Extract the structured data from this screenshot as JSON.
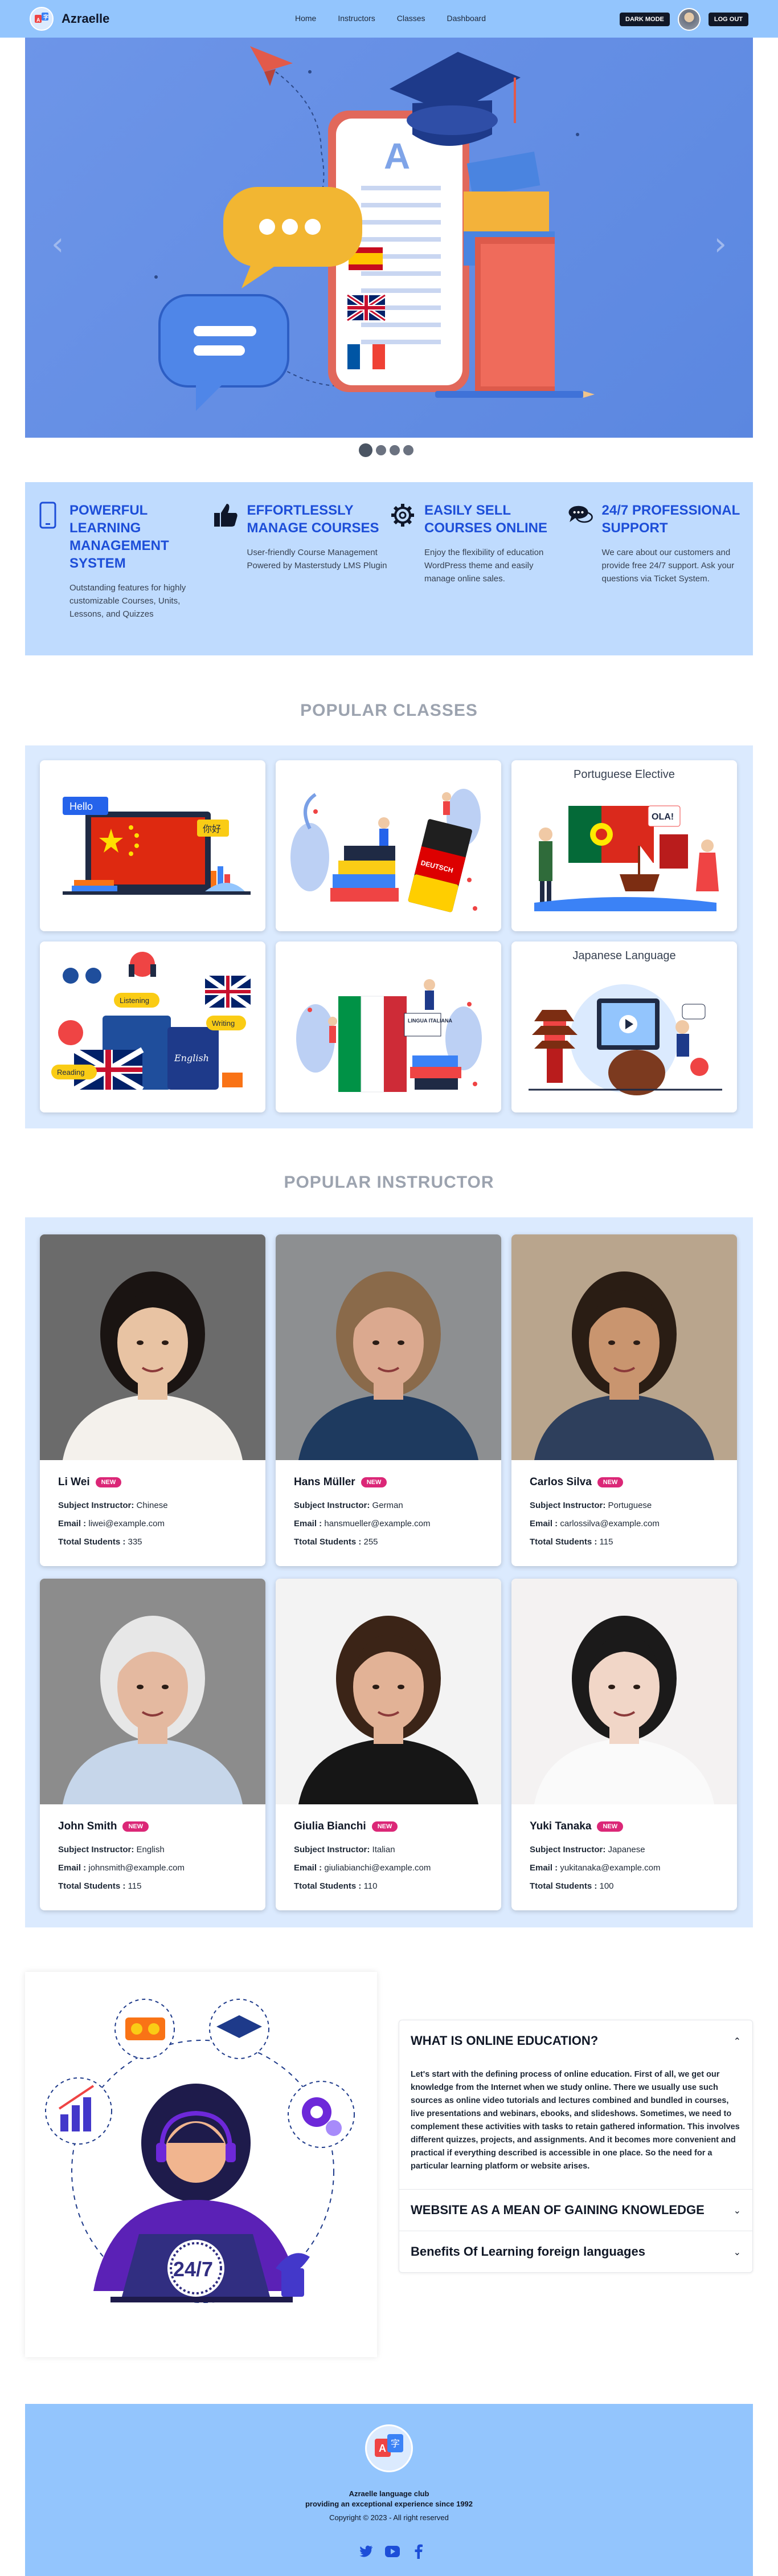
{
  "nav": {
    "brand": "Azraelle",
    "links": [
      "Home",
      "Instructors",
      "Classes",
      "Dashboard"
    ],
    "dark_mode": "DARK MODE",
    "logout": "LOG OUT"
  },
  "hero": {
    "prev_icon": "chevron-left-icon",
    "next_icon": "chevron-right-icon",
    "slides_total": 4,
    "active_slide": 1
  },
  "features": [
    {
      "icon": "phone-icon",
      "title": "Powerful Learning Management System",
      "desc": "Outstanding features for highly customizable Courses, Units, Lessons, and Quizzes"
    },
    {
      "icon": "thumbs-up-icon",
      "title": "Effortlessly Manage Courses",
      "desc": "User-friendly Course Management Powered by Masterstudy LMS Plugin"
    },
    {
      "icon": "gear-icon",
      "title": "Easily Sell Courses Online",
      "desc": "Enjoy the flexibility of education WordPress theme and easily manage online sales."
    },
    {
      "icon": "chat-icon",
      "title": "24/7 Professional Support",
      "desc": "We care about our customers and provide free 24/7 support. Ask your questions via Ticket System."
    }
  ],
  "classes": {
    "title": "POPULAR CLASSES",
    "cards": [
      {
        "name": "chinese",
        "label": "",
        "sign1": "Hello",
        "sign2": "你好"
      },
      {
        "name": "german",
        "label": "",
        "sign1": "DEUTSCH",
        "sign2": ""
      },
      {
        "name": "portuguese",
        "label": "Portuguese Elective",
        "sign1": "OLA!",
        "sign2": ""
      },
      {
        "name": "english",
        "label": "",
        "sign1": "Listening",
        "sign2": "Writing",
        "sign3": "Reading",
        "sign4": "English"
      },
      {
        "name": "italian",
        "label": "",
        "sign1": "LINGUA ITALIANA",
        "sign2": ""
      },
      {
        "name": "japanese",
        "label": "Japanese Language",
        "sign1": "",
        "sign2": ""
      }
    ]
  },
  "instructors": {
    "title": "POPULAR INSTRUCTOR",
    "badge": "NEW",
    "labels": {
      "subject": "Subject Instructor:",
      "email": "Email :",
      "students": "Ttotal Students :"
    },
    "items": [
      {
        "name": "Li Wei",
        "subject": "Chinese",
        "email": "liwei@example.com",
        "students": "335",
        "skin": "#e8c3a3",
        "hair": "#1a1412",
        "shirt": "#f4f1ec",
        "bg": "#6b6b6b"
      },
      {
        "name": "Hans Müller",
        "subject": "German",
        "email": "hansmueller@example.com",
        "students": "255",
        "skin": "#dba98f",
        "hair": "#8a6a4a",
        "shirt": "#1e3a5f",
        "bg": "#8d8f91"
      },
      {
        "name": "Carlos Silva",
        "subject": "Portuguese",
        "email": "carlossilva@example.com",
        "students": "115",
        "skin": "#c9956f",
        "hair": "#2a1d14",
        "shirt": "#2e3f5c",
        "bg": "#b9a58d"
      },
      {
        "name": "John Smith",
        "subject": "English",
        "email": "johnsmith@example.com",
        "students": "115",
        "skin": "#e4b9a0",
        "hair": "#e7e7e7",
        "shirt": "#c6d6ea",
        "bg": "#8c8c8c"
      },
      {
        "name": "Giulia Bianchi",
        "subject": "Italian",
        "email": "giuliabianchi@example.com",
        "students": "110",
        "skin": "#e2b296",
        "hair": "#3b2417",
        "shirt": "#161616",
        "bg": "#f3f3f3"
      },
      {
        "name": "Yuki Tanaka",
        "subject": "Japanese",
        "email": "yukitanaka@example.com",
        "students": "100",
        "skin": "#f1d6c7",
        "hair": "#1b1a1a",
        "shirt": "#fafafa",
        "bg": "#f4f2f2"
      }
    ]
  },
  "faq": {
    "image_text": "24/7",
    "items": [
      {
        "title": "WHAT IS ONLINE EDUCATION?",
        "open": true,
        "chevron": "chevron-up-icon",
        "body": "Let's start with the defining process of online education. First of all, we get our knowledge from the Internet when we study online. There we usually use such sources as online video tutorials and lectures combined and bundled in courses, live presentations and webinars, ebooks, and slideshows. Sometimes, we need to complement these activities with tasks to retain gathered information. This involves different quizzes, projects, and assignments. And it becomes more convenient and practical if everything described is accessible in one place. So the need for a particular learning platform or website arises."
      },
      {
        "title": "WEBSITE AS A MEAN OF GAINING KNOWLEDGE",
        "open": false,
        "chevron": "chevron-down-icon",
        "body": ""
      },
      {
        "title": "Benefits Of Learning foreign languages",
        "open": false,
        "chevron": "chevron-down-icon",
        "body": ""
      }
    ]
  },
  "footer": {
    "line1": "Azraelle language club",
    "line2": "providing an exceptional experience since 1992",
    "copyright": "Copyright © 2023 - All right reserved",
    "social": [
      "twitter-icon",
      "youtube-icon",
      "facebook-icon"
    ]
  },
  "colors": {
    "primary": "#1d4ed8",
    "navbar": "#93c5fd",
    "panel": "#dbeafe",
    "features_bg": "#bfdbfe",
    "badge": "#db2777"
  }
}
